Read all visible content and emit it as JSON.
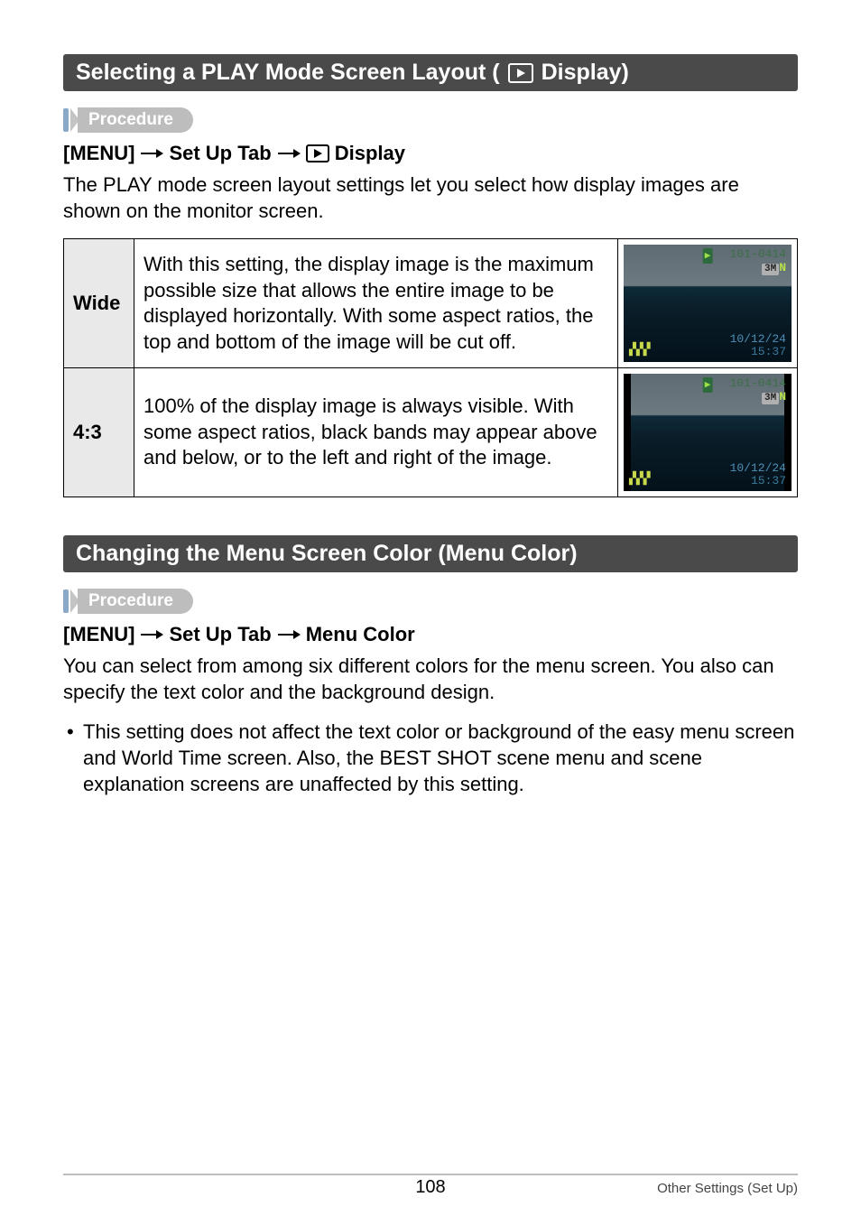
{
  "sections": {
    "play_layout": {
      "title_pre": "Selecting a PLAY Mode Screen Layout (",
      "title_post": " Display)",
      "procedure_label": "Procedure",
      "path": {
        "p1": "[MENU]",
        "p2": "Set Up Tab",
        "p3": "Display"
      },
      "intro": "The PLAY mode screen layout settings let you select how display images are shown on the monitor screen.",
      "rows": {
        "wide": {
          "key": "Wide",
          "desc": "With this setting, the display image is the maximum possible size that allows the entire image to be displayed horizontally. With some aspect ratios, the top and bottom of the image will be cut off."
        },
        "r43": {
          "key": "4:3",
          "desc": "100% of the display image is always visible. With some aspect ratios, black bands may appear above and below, or to the left and right of the image."
        }
      },
      "thumb": {
        "file": "101-0414",
        "size_badge": "3M",
        "flag": "N",
        "date": "10/12/24",
        "time": "15:37",
        "battery": "▞▞▞"
      }
    },
    "menu_color": {
      "title": "Changing the Menu Screen Color (Menu Color)",
      "procedure_label": "Procedure",
      "path": {
        "p1": "[MENU]",
        "p2": "Set Up Tab",
        "p3": "Menu Color"
      },
      "intro": "You can select from among six different colors for the menu screen. You also can specify the text color and the background design.",
      "note": "This setting does not affect the text color or background of the easy menu screen and World Time screen. Also, the BEST SHOT scene menu and scene explanation screens are unaffected by this setting."
    }
  },
  "footer": {
    "page": "108",
    "section": "Other Settings (Set Up)"
  }
}
